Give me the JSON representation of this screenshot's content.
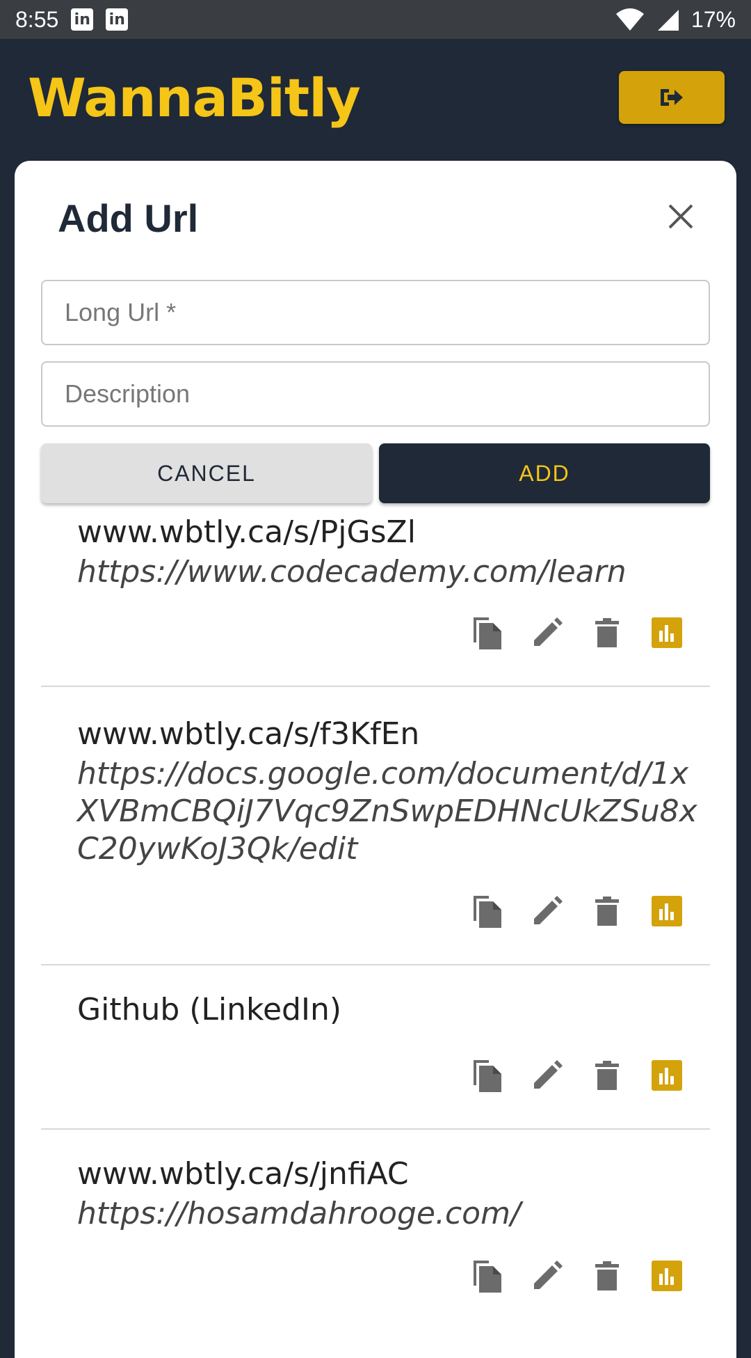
{
  "status_bar": {
    "time": "8:55",
    "notif_1": "in",
    "notif_2": "in",
    "battery": "17%"
  },
  "header": {
    "brand": "WannaBitly",
    "logout_icon": "sign-out-icon"
  },
  "dialog": {
    "title": "Add Url",
    "close_icon": "close-icon",
    "long_url_placeholder": "Long Url *",
    "description_placeholder": "Description",
    "cancel_label": "CANCEL",
    "add_label": "ADD"
  },
  "links": [
    {
      "short": "www.wbtly.ca/s/PjGsZl",
      "long": "https://www.codecademy.com/learn"
    },
    {
      "short": "www.wbtly.ca/s/f3KfEn",
      "long": "https://docs.google.com/document/d/1xXVBmCBQiJ7Vqc9ZnSwpEDHNcUkZSu8xC20ywKoJ3Qk/edit"
    },
    {
      "short": "Github (LinkedIn)",
      "long": ""
    },
    {
      "short": "www.wbtly.ca/s/jnfiAC",
      "long": "https://hosamdahrooge.com/"
    }
  ],
  "colors": {
    "header_bg": "#1f2937",
    "brand": "#f5c518",
    "accent": "#d4a20b",
    "icon_gray": "#6b6b6b"
  }
}
